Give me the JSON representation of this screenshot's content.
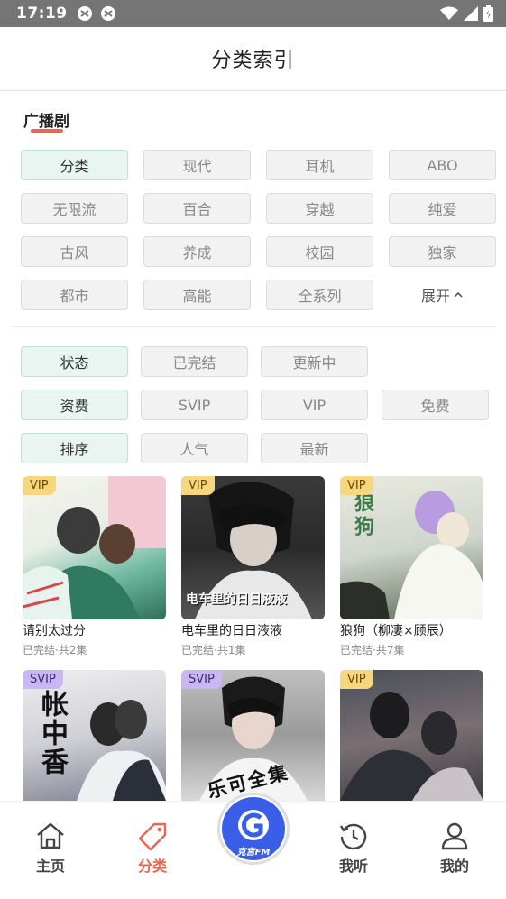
{
  "status": {
    "time": "17:19"
  },
  "header": {
    "title": "分类索引"
  },
  "section": {
    "title": "广播剧"
  },
  "categories": [
    "分类",
    "现代",
    "耳机",
    "ABO",
    "无限流",
    "百合",
    "穿越",
    "纯爱",
    "古风",
    "养成",
    "校园",
    "独家",
    "都市",
    "高能",
    "全系列"
  ],
  "expand_label": "展开",
  "filters": {
    "status": {
      "label": "状态",
      "options": [
        "已完结",
        "更新中"
      ]
    },
    "fee": {
      "label": "资费",
      "options": [
        "SVIP",
        "VIP",
        "免费"
      ]
    },
    "sort": {
      "label": "排序",
      "options": [
        "人气",
        "最新"
      ]
    }
  },
  "cards": [
    {
      "badge": "VIP",
      "title": "请别太过分",
      "sub": "已完结·共2集",
      "cover_art_text": ""
    },
    {
      "badge": "VIP",
      "title": "电车里的日日液液",
      "sub": "已完结·共1集",
      "cover_art_text": "电车里的日日液液"
    },
    {
      "badge": "VIP",
      "title": "狼狗（柳凄×顾辰）",
      "sub": "已完结·共7集",
      "cover_art_text": "狼狗"
    },
    {
      "badge": "SVIP",
      "title": "",
      "sub": "",
      "cover_art_text": "帐中香"
    },
    {
      "badge": "SVIP",
      "title": "",
      "sub": "",
      "cover_art_text": "乐可全集"
    },
    {
      "badge": "VIP",
      "title": "",
      "sub": "",
      "cover_art_text": ""
    }
  ],
  "nav": {
    "home": "主页",
    "category": "分类",
    "center_logo_text": "克宫FM",
    "listened": "我听",
    "mine": "我的"
  },
  "colors": {
    "accent": "#e9674f",
    "active_chip_bg": "#e8f5f1",
    "status_bar": "#757575"
  }
}
